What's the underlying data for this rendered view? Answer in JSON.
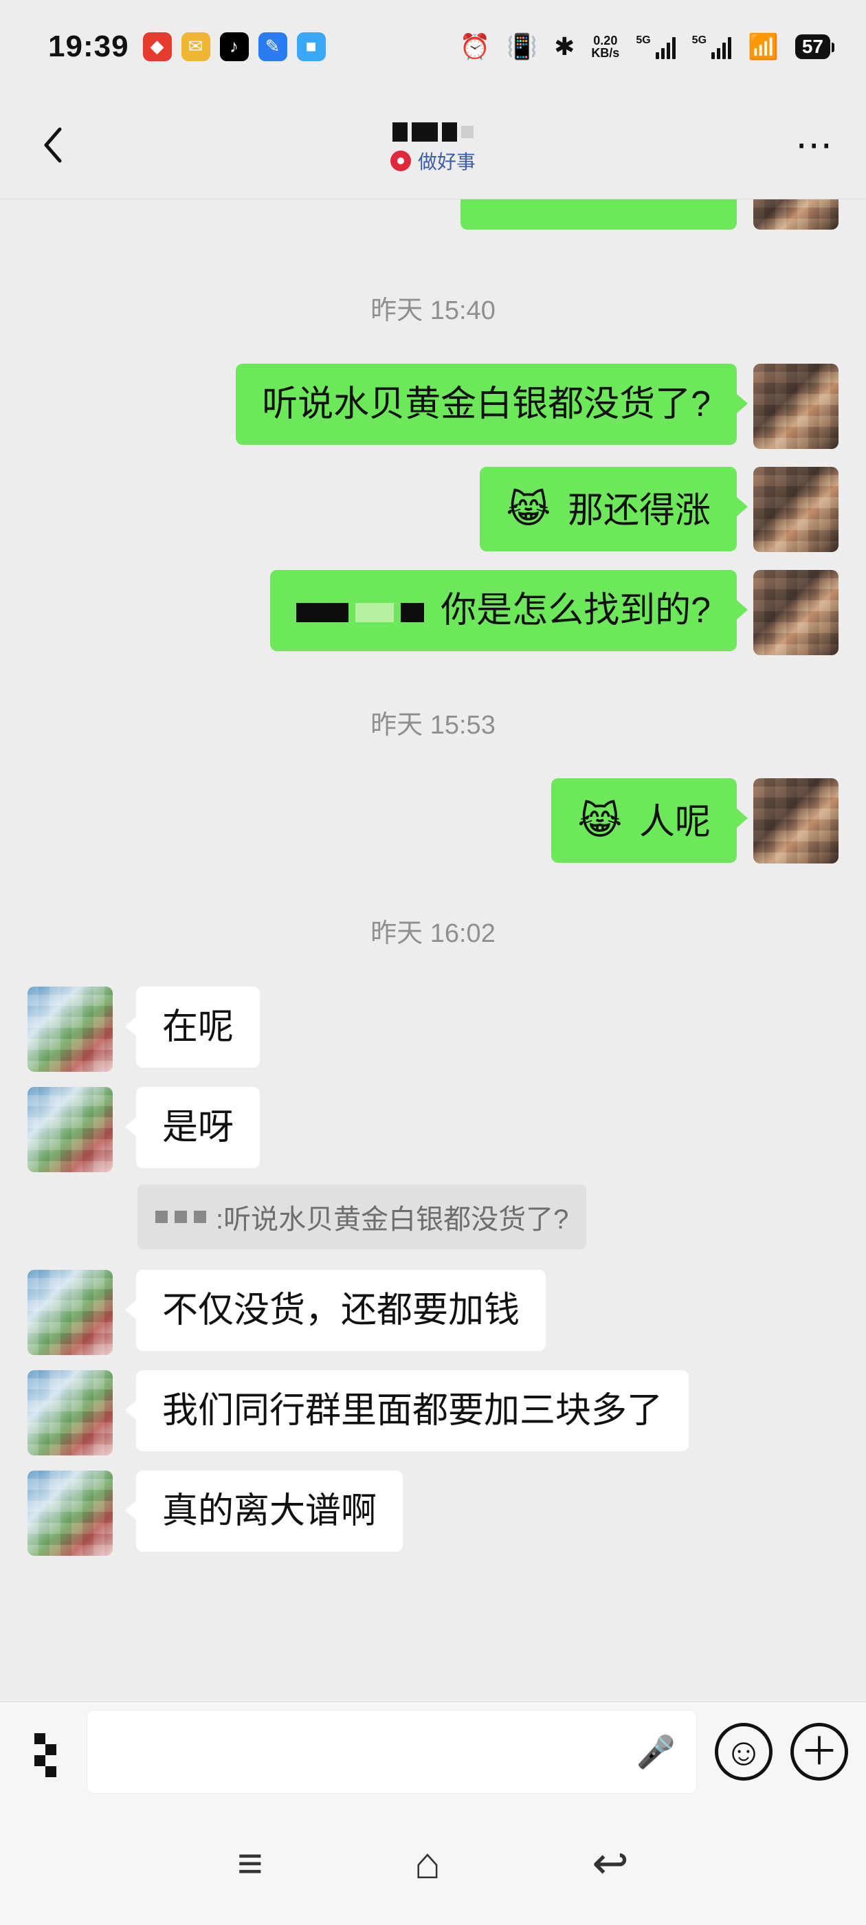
{
  "status_bar": {
    "time": "19:39",
    "network_speed_value": "0.20",
    "network_speed_unit": "KB/s",
    "sim1_label": "5G",
    "sim2_label": "5G",
    "battery": "57"
  },
  "header": {
    "subtitle": "做好事"
  },
  "chat": {
    "timestamps": [
      "昨天 15:40",
      "昨天 15:53",
      "昨天 16:02"
    ],
    "messages": {
      "me_1": "听说水贝黄金白银都没货了?",
      "me_2": "那还得涨",
      "me_3_suffix": "你是怎么找到的?",
      "me_4": "人呢",
      "other_1": "在呢",
      "other_2": "是呀",
      "quote_text": ":听说水贝黄金白银都没货了?",
      "other_3": "不仅没货，还都要加钱",
      "other_4": "我们同行群里面都要加三块多了",
      "other_5": "真的离大谱啊"
    }
  },
  "icons": {
    "back": "chevron-left-icon",
    "more": "more-horizontal-icon",
    "mic": "microphone-icon",
    "emoji": "emoji-icon",
    "plus": "plus-icon"
  },
  "nav": {
    "menu_glyph": "≡",
    "home_glyph": "⌂",
    "back_glyph": "↩"
  }
}
